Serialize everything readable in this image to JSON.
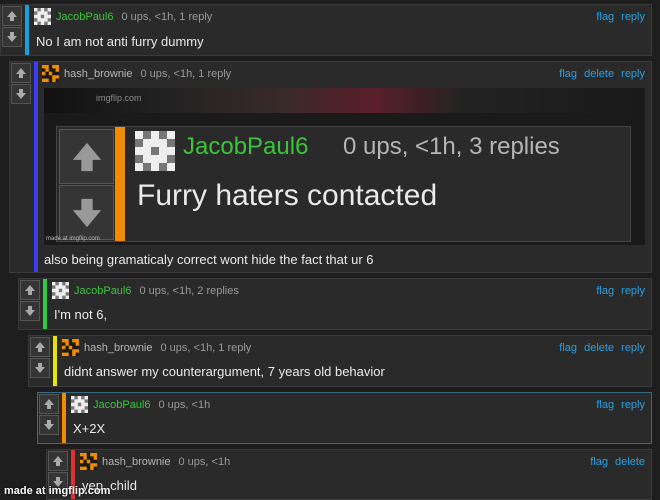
{
  "colors": {
    "link": "#2aa0e0",
    "username": "#3cc33c",
    "bar_blue_light": "#1aa0d8",
    "bar_blue": "#3c3cf0",
    "bar_green": "#2ecc40",
    "bar_yellow": "#e6e600",
    "bar_orange": "#f08c00",
    "bar_red": "#e03030"
  },
  "icons": {
    "up": "arrow-up-icon",
    "down": "arrow-down-icon"
  },
  "comments": [
    {
      "user": "JacobPaul6",
      "meta": "0 ups, <1h, 1 reply",
      "flag": "flag",
      "reply": "reply",
      "text": "No I am not anti furry dummy"
    },
    {
      "user": "hash_brownie",
      "meta": "0 ups, <1h, 1 reply",
      "flag": "flag",
      "delete": "delete",
      "reply": "reply",
      "text": "also being gramaticaly correct wont hide the fact that ur 6",
      "embed": {
        "watermark_top": "imgflip.com",
        "user": "JacobPaul6",
        "meta": "0 ups, <1h, 3 replies",
        "text": "Furry haters contacted",
        "watermark": "made at imgflip.com"
      }
    },
    {
      "user": "JacobPaul6",
      "meta": "0 ups, <1h, 2 replies",
      "flag": "flag",
      "reply": "reply",
      "text": "I'm not 6,"
    },
    {
      "user": "hash_brownie",
      "meta": "0 ups, <1h, 1 reply",
      "flag": "flag",
      "delete": "delete",
      "reply": "reply",
      "text": "didnt answer my counterargument, 7 years old behavior"
    },
    {
      "user": "JacobPaul6",
      "meta": "0 ups, <1h",
      "flag": "flag",
      "reply": "reply",
      "text": "X+2X"
    },
    {
      "user": "hash_brownie",
      "meta": "0 ups, <1h",
      "flag": "flag",
      "delete": "delete",
      "text": "yep, child"
    }
  ],
  "watermark": "made at imgflip.com"
}
